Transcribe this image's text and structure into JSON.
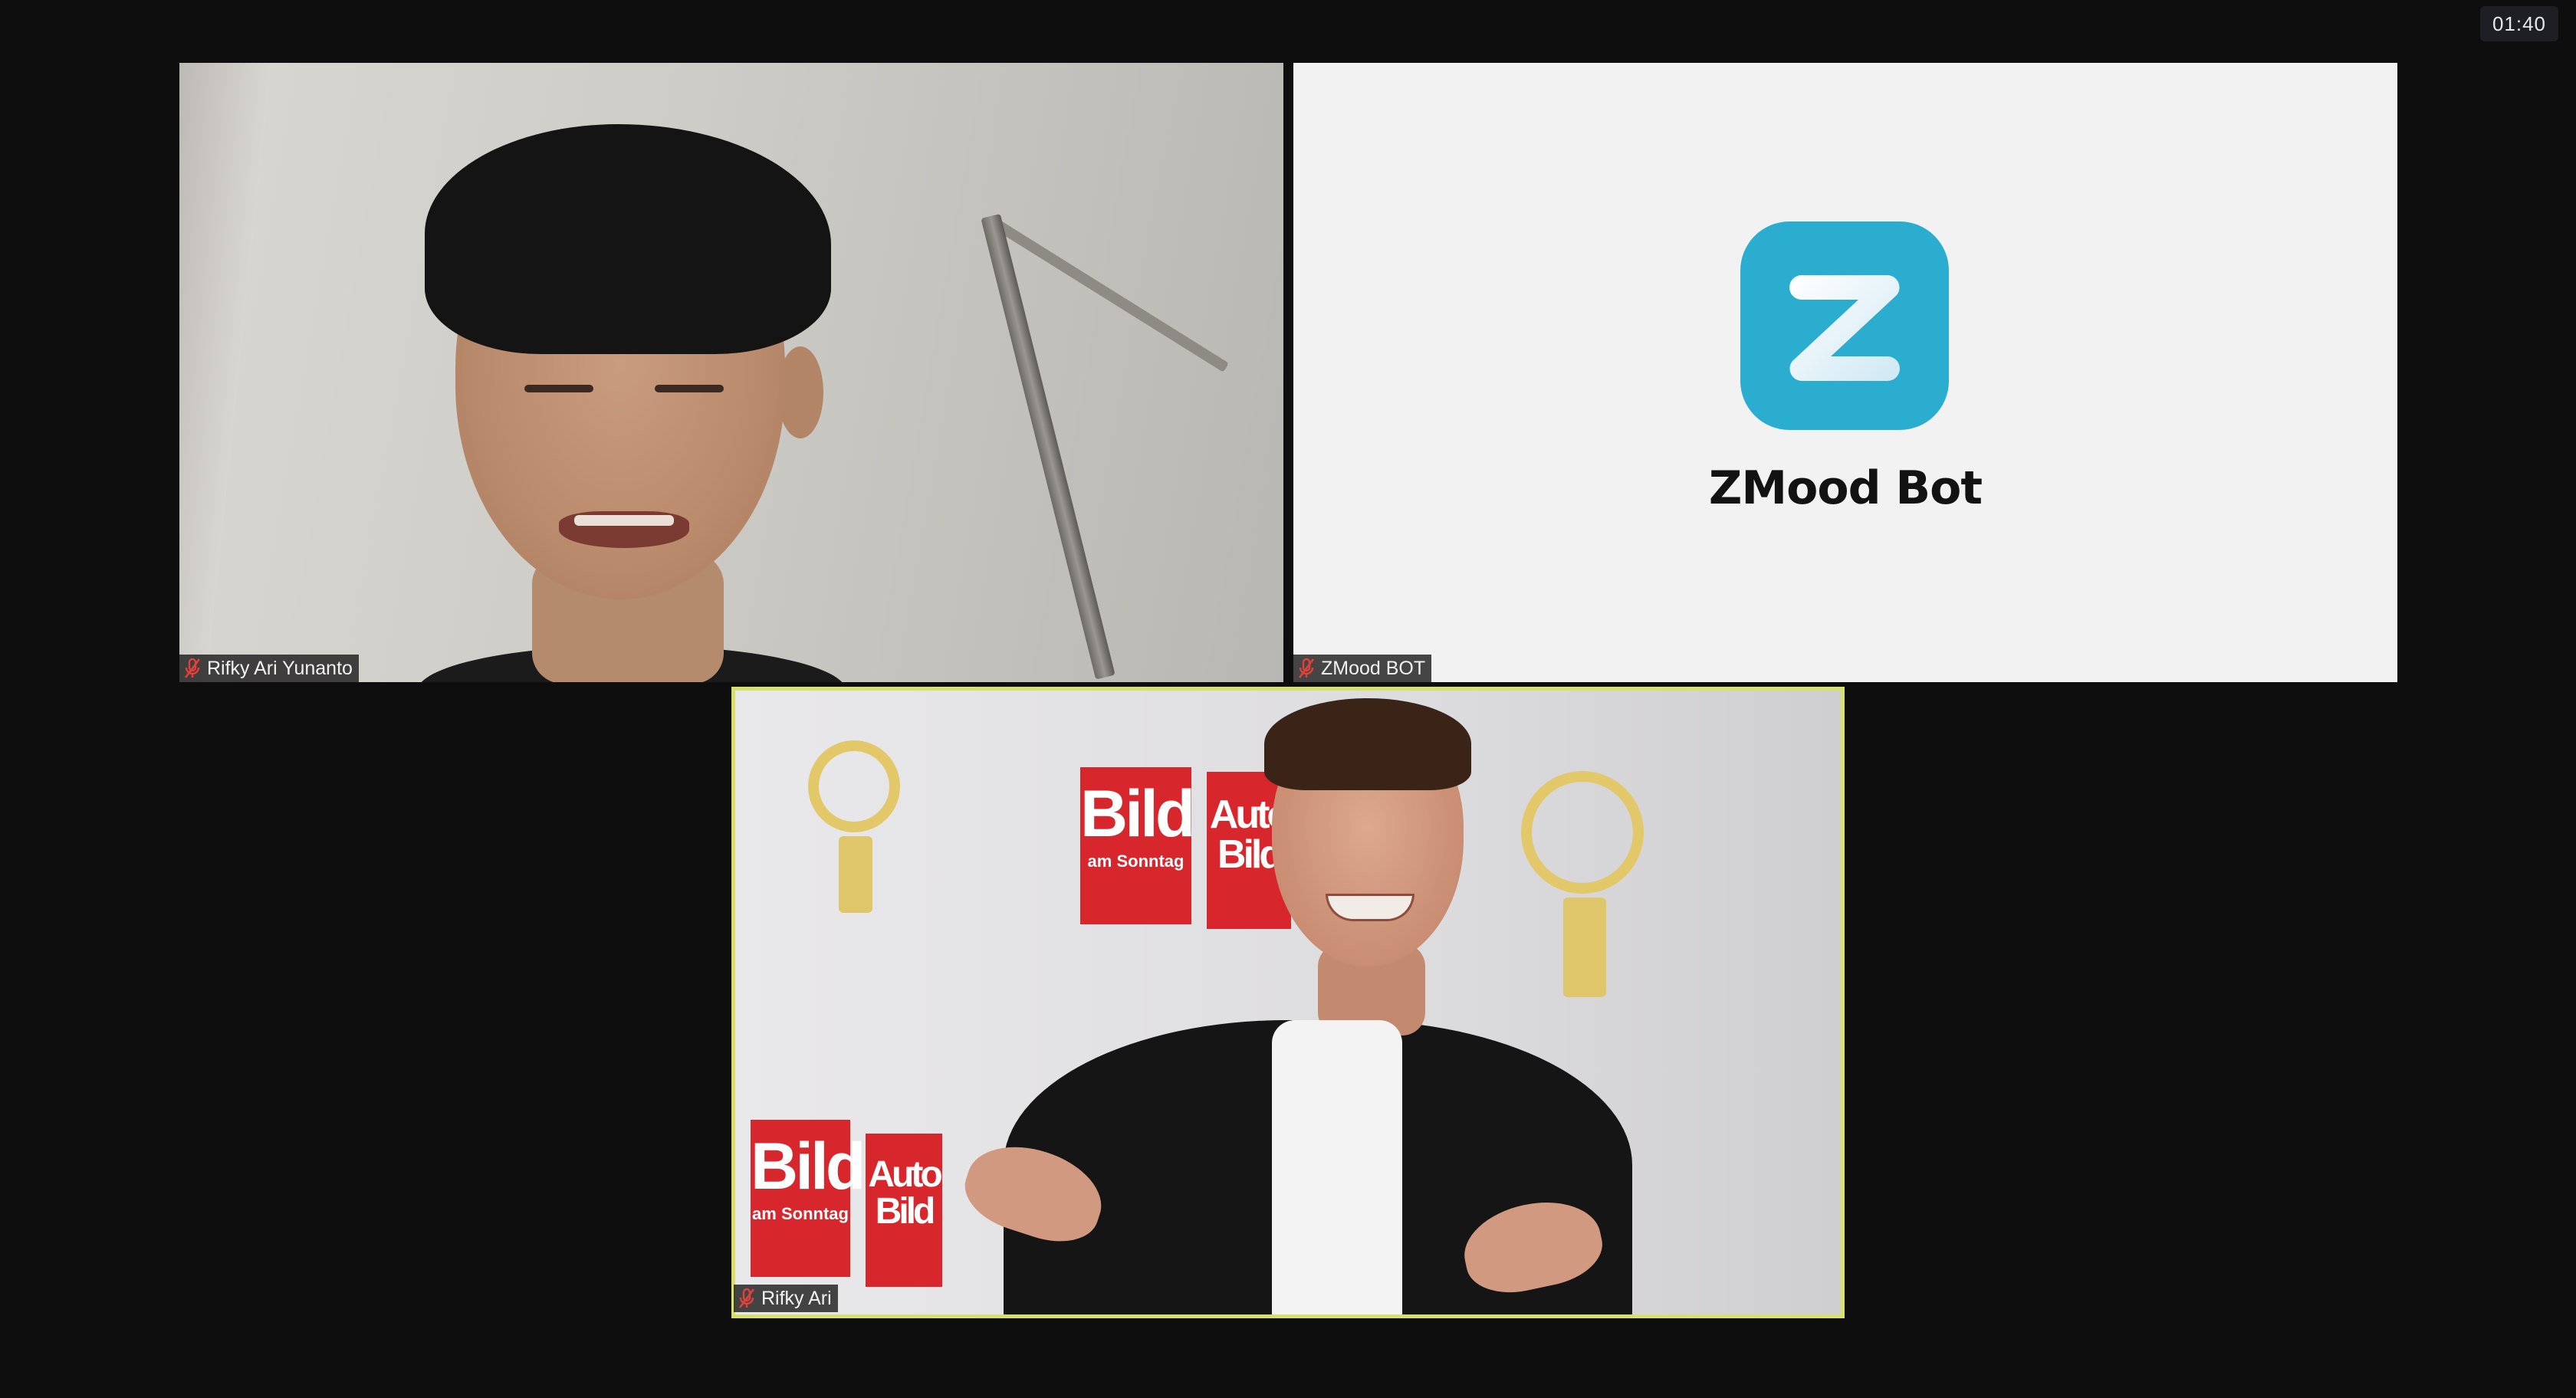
{
  "meeting": {
    "timer": "01:40"
  },
  "participants": [
    {
      "name": "Rifky Ari Yunanto",
      "muted": true,
      "active_speaker": false
    },
    {
      "name": "ZMood BOT",
      "muted": true,
      "active_speaker": false,
      "placeholder": {
        "logo_letter": "Z",
        "title": "ZMood Bot"
      }
    },
    {
      "name": "Rifky Ari",
      "muted": true,
      "active_speaker": true,
      "backdrop_text": {
        "brand1_big": "Bild",
        "brand1_small": "am Sonntag",
        "brand2_big": "Auto Bild"
      }
    }
  ],
  "colors": {
    "background": "#0e0e0e",
    "bot_tile_background": "#f2f2f3",
    "bot_logo": "#2aadcf",
    "active_speaker_border": "#d6e06a",
    "muted_icon": "#e0413a"
  },
  "icons": {
    "muted": "microphone-muted-icon",
    "logo": "zmood-logo-icon"
  }
}
